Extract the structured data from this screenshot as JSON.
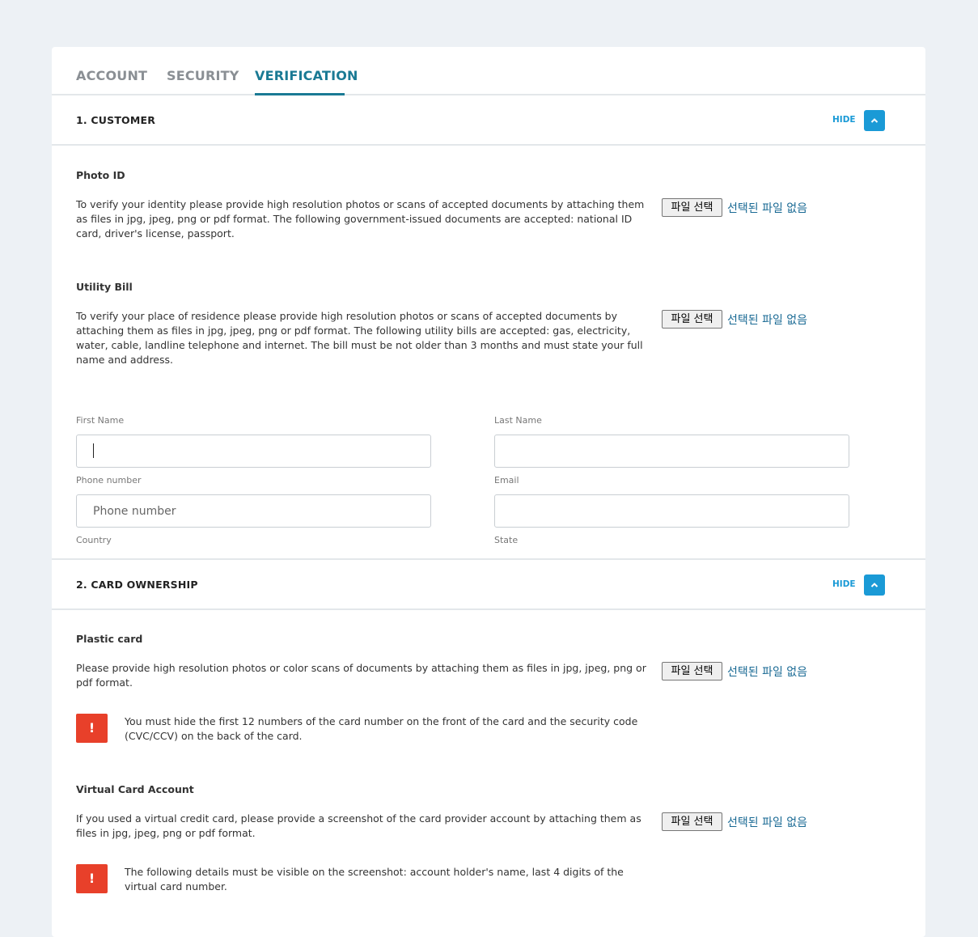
{
  "tabs": [
    {
      "label": "ACCOUNT"
    },
    {
      "label": "SECURITY"
    },
    {
      "label": "VERIFICATION"
    }
  ],
  "colors": {
    "accent": "#1a7a94",
    "button": "#1a9ad6",
    "warning": "#e8402a",
    "page_bg": "#edf1f5"
  },
  "sections": {
    "customer": {
      "title": "1. CUSTOMER",
      "hide_label": "HIDE",
      "photo_id": {
        "title": "Photo ID",
        "description": "To verify your identity please provide high resolution photos or scans of accepted documents by attaching them as files in jpg, jpeg, png or pdf format. The following government-issued documents are accepted: national ID card, driver's license, passport.",
        "file_button": "파일 선택",
        "file_status": "선택된 파일 없음"
      },
      "utility_bill": {
        "title": "Utility Bill",
        "description": "To verify your place of residence please provide high resolution photos or scans of accepted documents by attaching them as files in jpg, jpeg, png or pdf format. The following utility bills are accepted: gas, electricity, water, cable, landline telephone and internet. The bill must be not older than 3 months and must state your full name and address.",
        "file_button": "파일 선택",
        "file_status": "선택된 파일 없음"
      },
      "form": {
        "first_name": {
          "label": "First Name",
          "value": ""
        },
        "last_name": {
          "label": "Last Name",
          "value": ""
        },
        "phone": {
          "label": "Phone number",
          "placeholder": "Phone number"
        },
        "email": {
          "label": "Email",
          "value": ""
        },
        "country": {
          "label": "Country"
        },
        "state": {
          "label": "State"
        }
      }
    },
    "card_ownership": {
      "title": "2. CARD OWNERSHIP",
      "hide_label": "HIDE",
      "plastic_card": {
        "title": "Plastic card",
        "description": "Please provide high resolution photos or color scans of documents by attaching them as files in jpg, jpeg, png or pdf format.",
        "file_button": "파일 선택",
        "file_status": "선택된 파일 없음",
        "warning_icon": "!",
        "warning": "You must hide the first 12 numbers of the card number on the front of the card and the security code (CVC/CCV) on the back of the card."
      },
      "virtual_card": {
        "title": "Virtual Card Account",
        "description": "If you used a virtual credit card, please provide a screenshot of the card provider account by attaching them as files in jpg, jpeg, png or pdf format.",
        "file_button": "파일 선택",
        "file_status": "선택된 파일 없음",
        "warning_icon": "!",
        "warning": "The following details must be visible on the screenshot: account holder's name, last 4 digits of the virtual card number."
      }
    }
  }
}
